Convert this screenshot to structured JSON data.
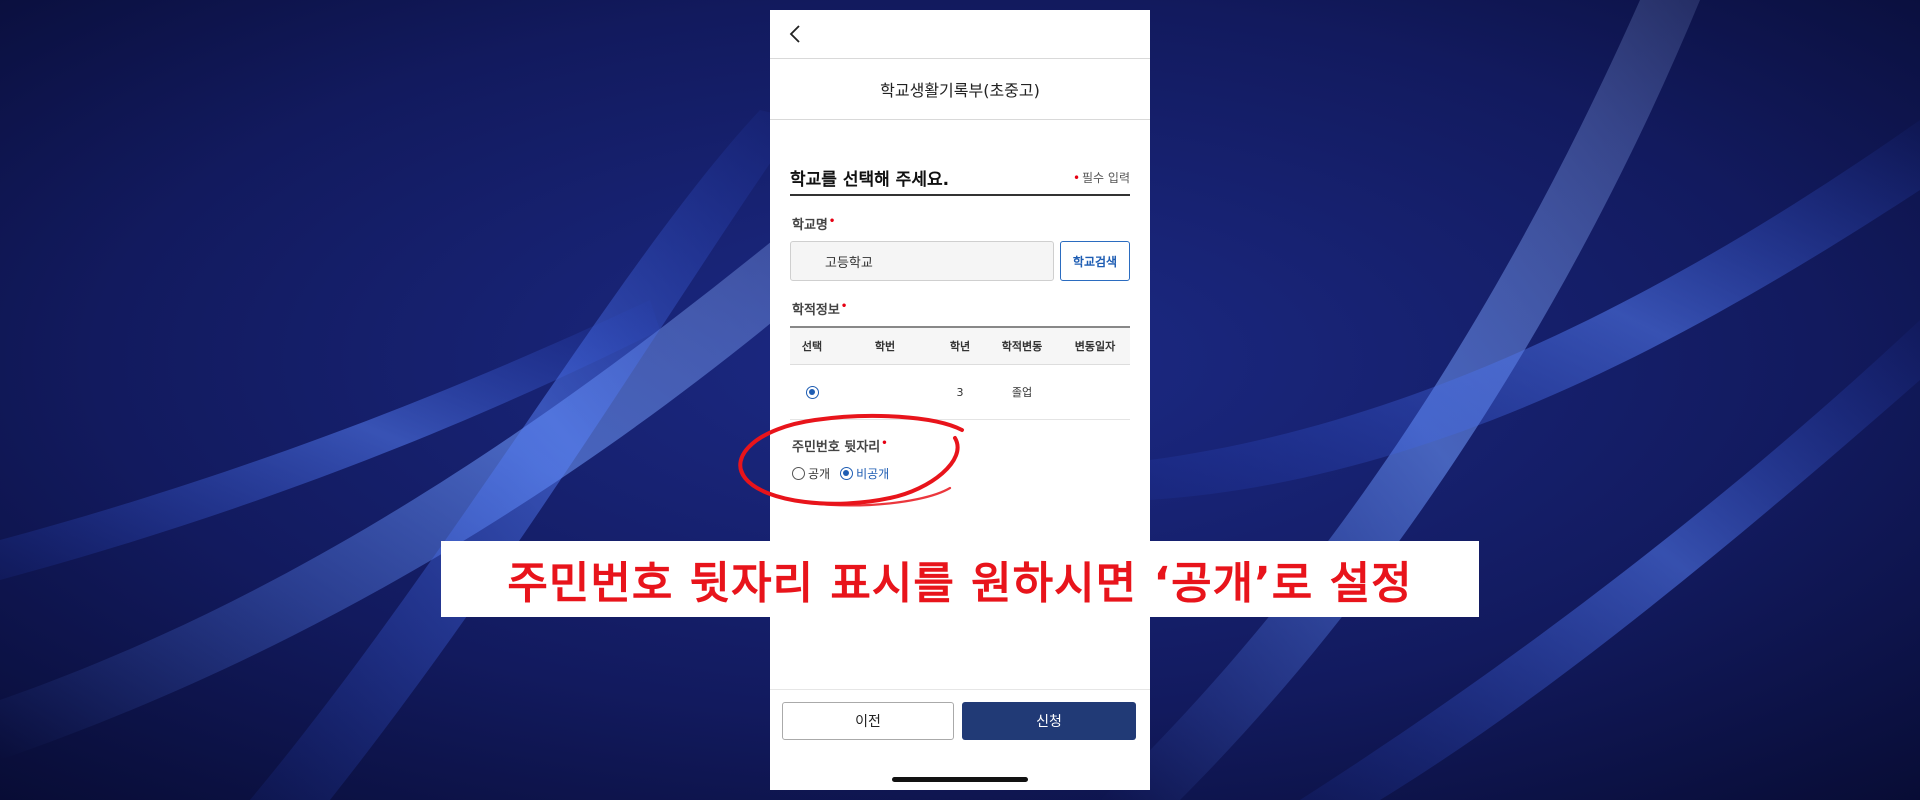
{
  "screen": {
    "title": "학교생활기록부(초중고)"
  },
  "form": {
    "heading": "학교를 선택해 주세요.",
    "required_note": "필수 입력",
    "required_marker": "•",
    "school_name": {
      "label": "학교명",
      "value": "고등학교",
      "search_button": "학교검색"
    },
    "record_info": {
      "label": "학적정보",
      "columns": [
        "선택",
        "학번",
        "학년",
        "학적변동",
        "변동일자"
      ],
      "rows": [
        {
          "selected": true,
          "student_no": "",
          "grade": "3",
          "status": "졸업",
          "change_date": ""
        }
      ]
    },
    "resident_no_suffix": {
      "label": "주민번호 뒷자리",
      "options": [
        {
          "label": "공개",
          "selected": false
        },
        {
          "label": "비공개",
          "selected": true
        }
      ]
    }
  },
  "footer": {
    "prev_button": "이전",
    "apply_button": "신청"
  },
  "annotation": {
    "banner_text": "주민번호 뒷자리 표시를 원하시면 ‘공개’로 설정",
    "highlight_color": "#e8141b"
  },
  "colors": {
    "background": "#0d1245",
    "accent_blue": "#1e5db3",
    "primary_button": "#213a76",
    "required_red": "#e60012"
  }
}
